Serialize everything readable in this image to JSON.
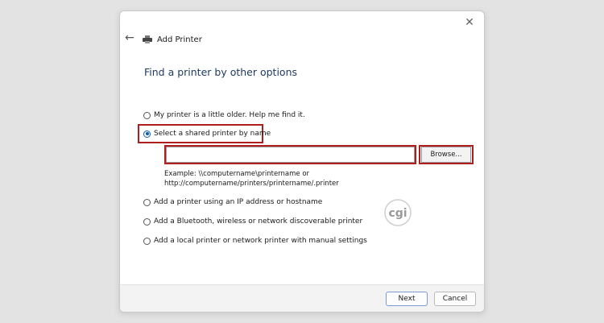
{
  "window": {
    "title": "Add Printer",
    "close_symbol": "✕",
    "back_symbol": "←",
    "icons": {
      "back": "arrow-left-icon",
      "close": "close-icon",
      "printer": "printer-icon"
    }
  },
  "page": {
    "heading": "Find a printer by other options"
  },
  "options": [
    {
      "label": "My printer is a little older. Help me find it.",
      "selected": false
    },
    {
      "label": "Select a shared printer by name",
      "selected": true
    },
    {
      "label": "Add a printer using an IP address or hostname",
      "selected": false
    },
    {
      "label": "Add a Bluetooth, wireless or network discoverable printer",
      "selected": false
    },
    {
      "label": "Add a local printer or network printer with manual settings",
      "selected": false
    }
  ],
  "shared_printer": {
    "value": "",
    "browse_label": "Browse...",
    "example_line1": "Example: \\\\computername\\printername or",
    "example_line2": "http://computername/printers/printername/.printer"
  },
  "watermark": {
    "text": "cgi"
  },
  "footer": {
    "next_label": "Next",
    "cancel_label": "Cancel"
  },
  "colors": {
    "highlight": "#b01e1e",
    "radio_selected": "#0b5cad",
    "heading": "#1f3b60"
  }
}
